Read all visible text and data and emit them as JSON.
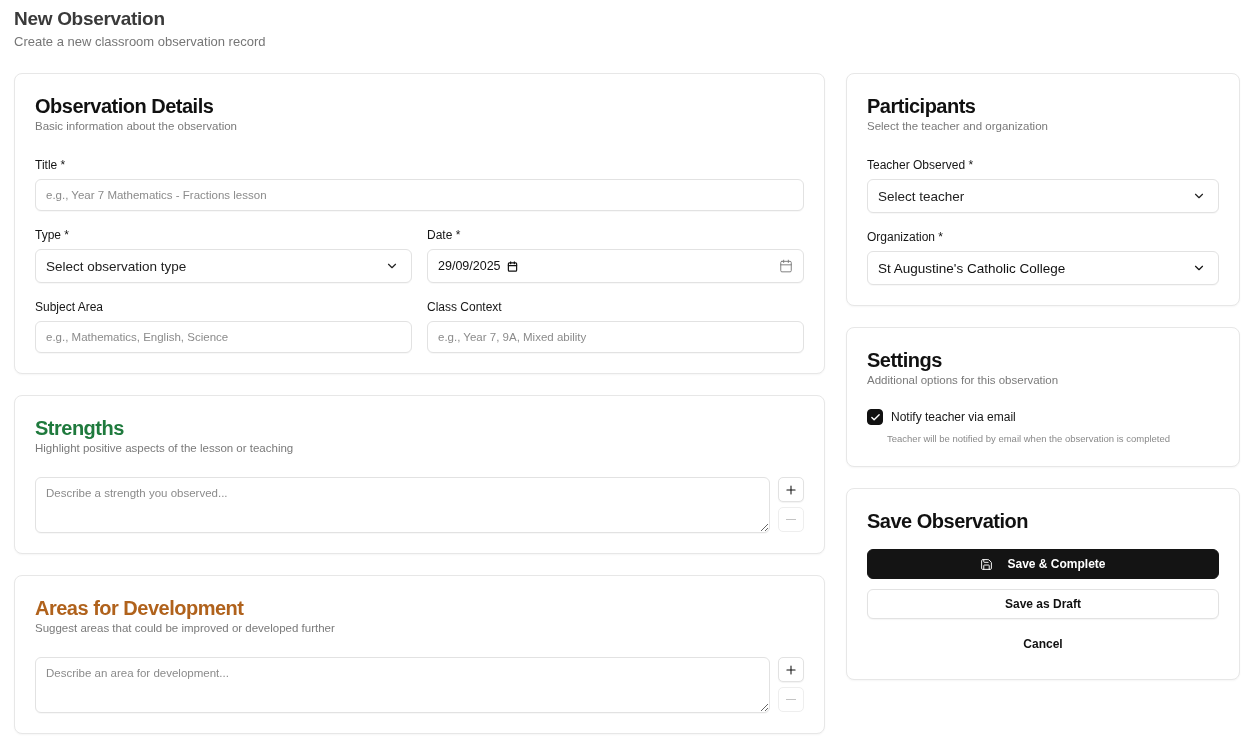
{
  "header": {
    "title": "New Observation",
    "subtitle": "Create a new classroom observation record"
  },
  "observation_details": {
    "title": "Observation Details",
    "subtitle": "Basic information about the observation",
    "rows": [
      [
        {
          "kind": "text",
          "label": "Title *",
          "placeholder": "e.g., Year 7 Mathematics - Fractions lesson"
        }
      ],
      [
        {
          "kind": "select",
          "label": "Type *",
          "placeholder": "Select observation type"
        },
        {
          "kind": "date",
          "label": "Date *",
          "value": "29/09/2025"
        }
      ],
      [
        {
          "kind": "text",
          "label": "Subject Area",
          "placeholder": "e.g., Mathematics, English, Science"
        },
        {
          "kind": "text",
          "label": "Class Context",
          "placeholder": "e.g., Year 7, 9A, Mixed ability"
        }
      ]
    ]
  },
  "feedback_sections": [
    {
      "title": "Strengths",
      "color": "#1f7a3d",
      "subtitle": "Highlight positive aspects of the lesson or teaching",
      "entries": [
        {
          "placeholder": "Describe a strength you observed...",
          "add_disabled": false,
          "remove_disabled": true
        }
      ]
    },
    {
      "title": "Areas for Development",
      "color": "#b0621c",
      "subtitle": "Suggest areas that could be improved or developed further",
      "entries": [
        {
          "placeholder": "Describe an area for development...",
          "add_disabled": false,
          "remove_disabled": true
        }
      ]
    }
  ],
  "participants": {
    "title": "Participants",
    "subtitle": "Select the teacher and organization",
    "fields": [
      {
        "kind": "select",
        "label": "Teacher Observed *",
        "placeholder": "Select teacher"
      },
      {
        "kind": "select",
        "label": "Organization *",
        "value": "St Augustine's Catholic College"
      }
    ]
  },
  "settings": {
    "title": "Settings",
    "subtitle": "Additional options for this observation",
    "options": [
      {
        "label": "Notify teacher via email",
        "checked": true,
        "hint": "Teacher will be notified by email when the observation is completed"
      }
    ]
  },
  "save": {
    "title": "Save Observation",
    "buttons": [
      {
        "kind": "primary",
        "label": "Save & Complete"
      },
      {
        "kind": "outline",
        "label": "Save as Draft"
      },
      {
        "kind": "ghost",
        "label": "Cancel"
      }
    ]
  }
}
